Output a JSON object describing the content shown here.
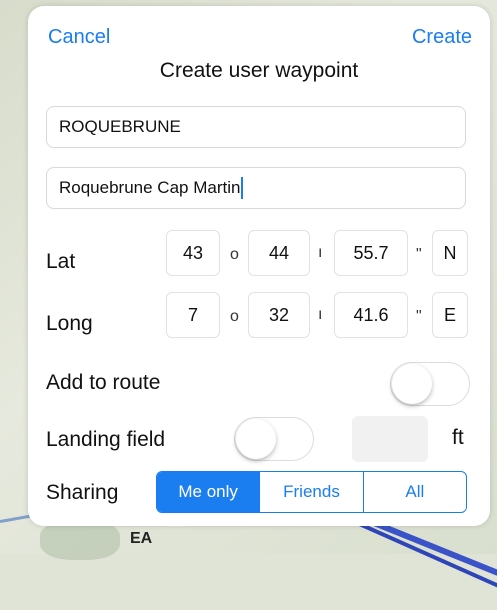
{
  "map": {
    "label": "EA"
  },
  "dialog": {
    "cancel_label": "Cancel",
    "create_label": "Create",
    "title": "Create user waypoint",
    "identifier_value": "ROQUEBRUNE",
    "name_value": "Roquebrune Cap Martin",
    "lat": {
      "label": "Lat",
      "deg": "43",
      "min": "44",
      "sec": "55.7",
      "hemisphere": "N"
    },
    "long": {
      "label": "Long",
      "deg": "7",
      "min": "32",
      "sec": "41.6",
      "hemisphere": "E"
    },
    "symbols": {
      "degree": "o",
      "minute": "ı",
      "second": "\""
    },
    "add_to_route": {
      "label": "Add to route",
      "on": false
    },
    "landing_field": {
      "label": "Landing field",
      "on": false,
      "elevation": "",
      "unit": "ft"
    },
    "sharing": {
      "label": "Sharing",
      "options": [
        "Me only",
        "Friends",
        "All"
      ],
      "selected": "Me only"
    }
  },
  "colors": {
    "accent": "#1a7df0"
  }
}
